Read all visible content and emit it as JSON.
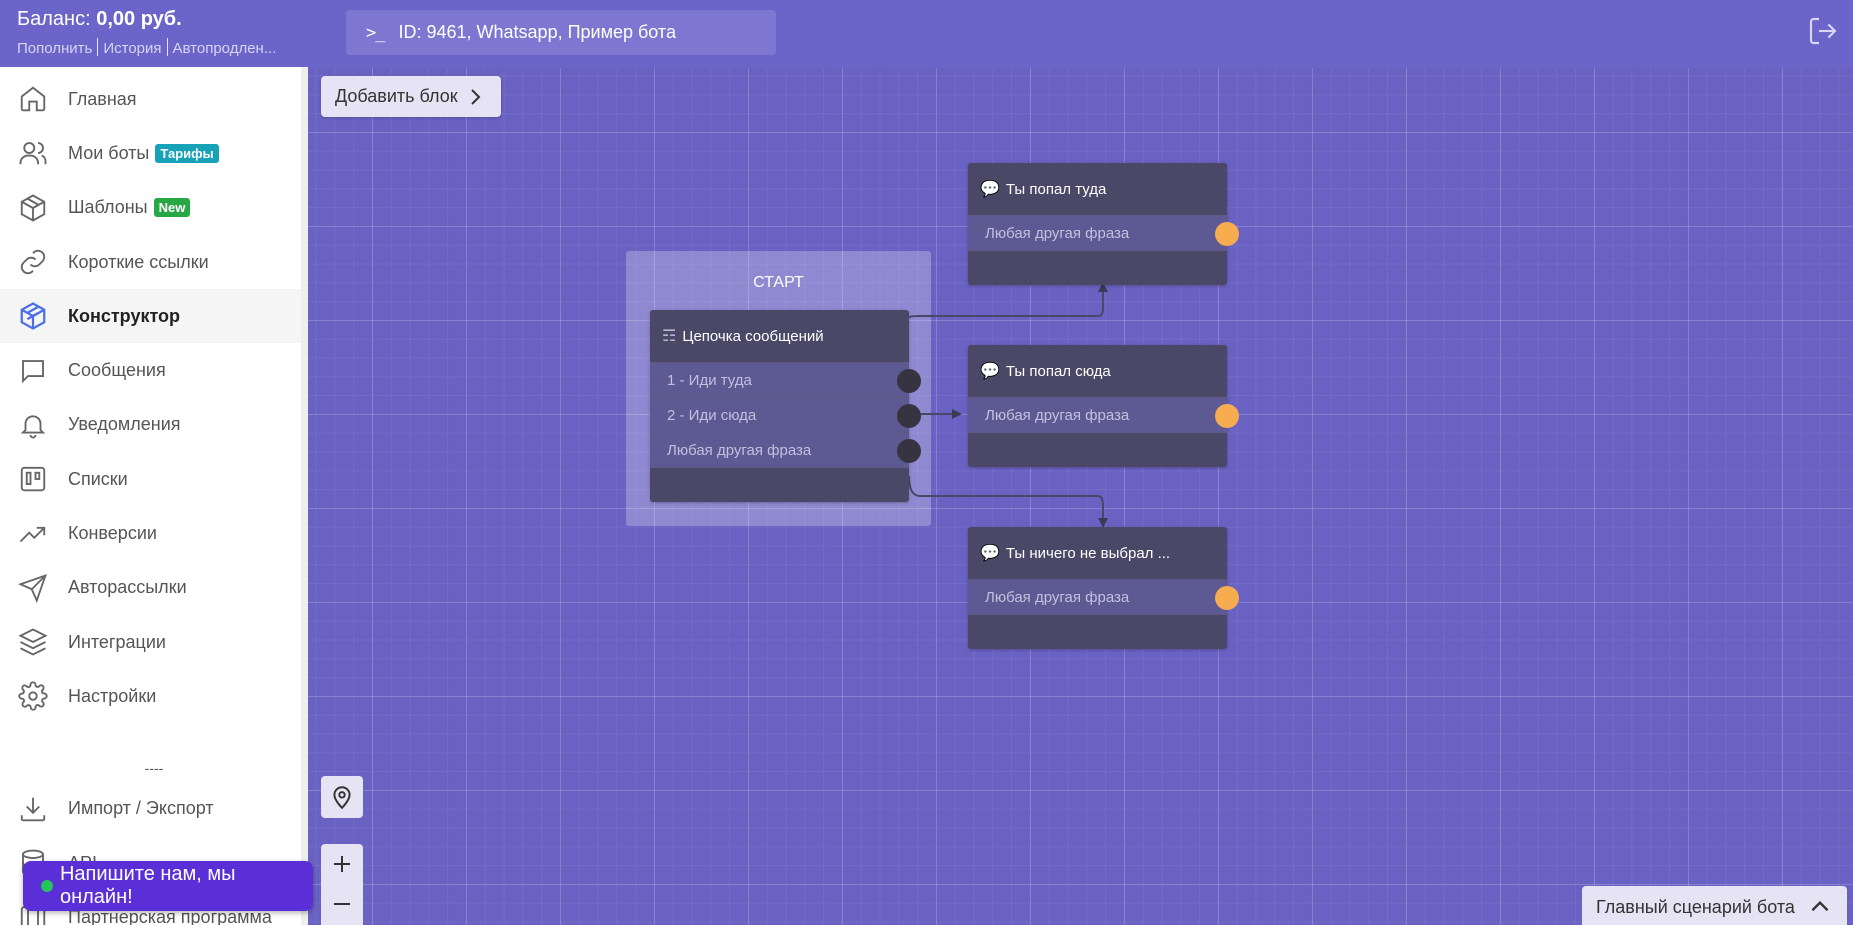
{
  "balance": {
    "label": "Баланс:",
    "amount": "0,00 руб.",
    "links": [
      "Пополнить",
      "История",
      "Автопродлен..."
    ]
  },
  "menu": [
    {
      "label": "Главная",
      "icon": "home-icon"
    },
    {
      "label": "Мои боты",
      "icon": "users-icon",
      "badge": "Тарифы",
      "badge_color": "#17a2b8"
    },
    {
      "label": "Шаблоны",
      "icon": "package-icon",
      "badge": "New",
      "badge_color": "#28a745"
    },
    {
      "label": "Короткие ссылки",
      "icon": "link-icon"
    },
    {
      "label": "Конструктор",
      "icon": "cube-icon",
      "active": true
    },
    {
      "label": "Сообщения",
      "icon": "message-icon"
    },
    {
      "label": "Уведомления",
      "icon": "bell-icon"
    },
    {
      "label": "Списки",
      "icon": "board-icon"
    },
    {
      "label": "Конверсии",
      "icon": "trend-icon"
    },
    {
      "label": "Авторассылки",
      "icon": "send-icon"
    },
    {
      "label": "Интеграции",
      "icon": "layers-icon"
    },
    {
      "label": "Настройки",
      "icon": "gear-icon"
    }
  ],
  "divider": "----",
  "menu_bottom": [
    {
      "label": "Импорт / Экспорт",
      "icon": "download-icon"
    },
    {
      "label": "API",
      "icon": "database-icon"
    },
    {
      "label": "Партнерская программа",
      "icon": "partner-icon"
    }
  ],
  "chat": {
    "label": "Напишите нам, мы онлайн!"
  },
  "topbar": {
    "bot_id": "ID: 9461, Whatsapp, Пример бота"
  },
  "canvas": {
    "add_block": "Добавить блок",
    "start_label": "СТАРТ",
    "scenario": "Главный сценарий бота"
  },
  "nodes": {
    "chain": {
      "title": "Цепочка сообщений",
      "rows": [
        "1 - Иди туда",
        "2 - Иди сюда",
        "Любая другая фраза"
      ]
    },
    "there": {
      "title": "Ты попал туда",
      "row": "Любая другая фраза"
    },
    "here": {
      "title": "Ты попал сюда",
      "row": "Любая другая фраза"
    },
    "nothing": {
      "title": "Ты ничего не выбрал ...",
      "row": "Любая другая фраза"
    }
  },
  "colors": {
    "brand": "#6b64c9",
    "accent_orange": "#f7ac4f",
    "chat_button": "#5b2fd7"
  }
}
